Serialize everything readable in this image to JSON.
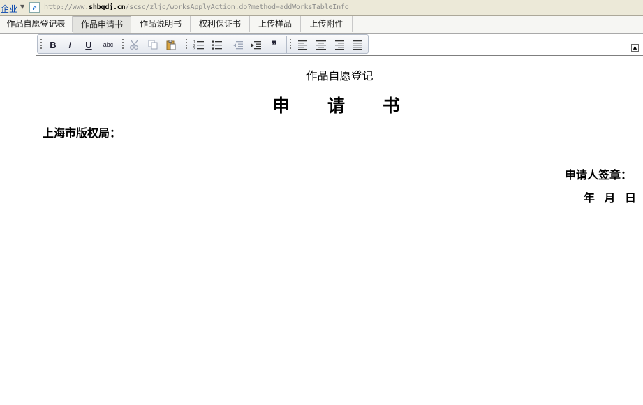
{
  "address_bar": {
    "entity": "企业",
    "url_prefix": "http://www.",
    "url_domain": "shbqdj.cn",
    "url_path": "/scsc/zljc/worksApplyAction.do?method=addWorksTableInfo"
  },
  "tabs": [
    {
      "label": "作品自愿登记表",
      "active": false
    },
    {
      "label": "作品申请书",
      "active": true
    },
    {
      "label": "作品说明书",
      "active": false
    },
    {
      "label": "权利保证书",
      "active": false
    },
    {
      "label": "上传样品",
      "active": false
    },
    {
      "label": "上传附件",
      "active": false
    }
  ],
  "toolbar": {
    "bold": "B",
    "italic": "I",
    "underline": "U",
    "strikethrough": "abc",
    "blockquote": "❞"
  },
  "document": {
    "subtitle": "作品自愿登记",
    "title": "申请书",
    "addressee": "上海市版权局：",
    "signature": "申请人签章：",
    "date": "年 月 日"
  },
  "colors": {
    "chrome_bg": "#ece9d8",
    "tab_bg": "#f6f6f3",
    "active_tab_bg": "#e4e4e0",
    "toolbar_border": "#b4bcc9",
    "link": "#0645ad"
  }
}
